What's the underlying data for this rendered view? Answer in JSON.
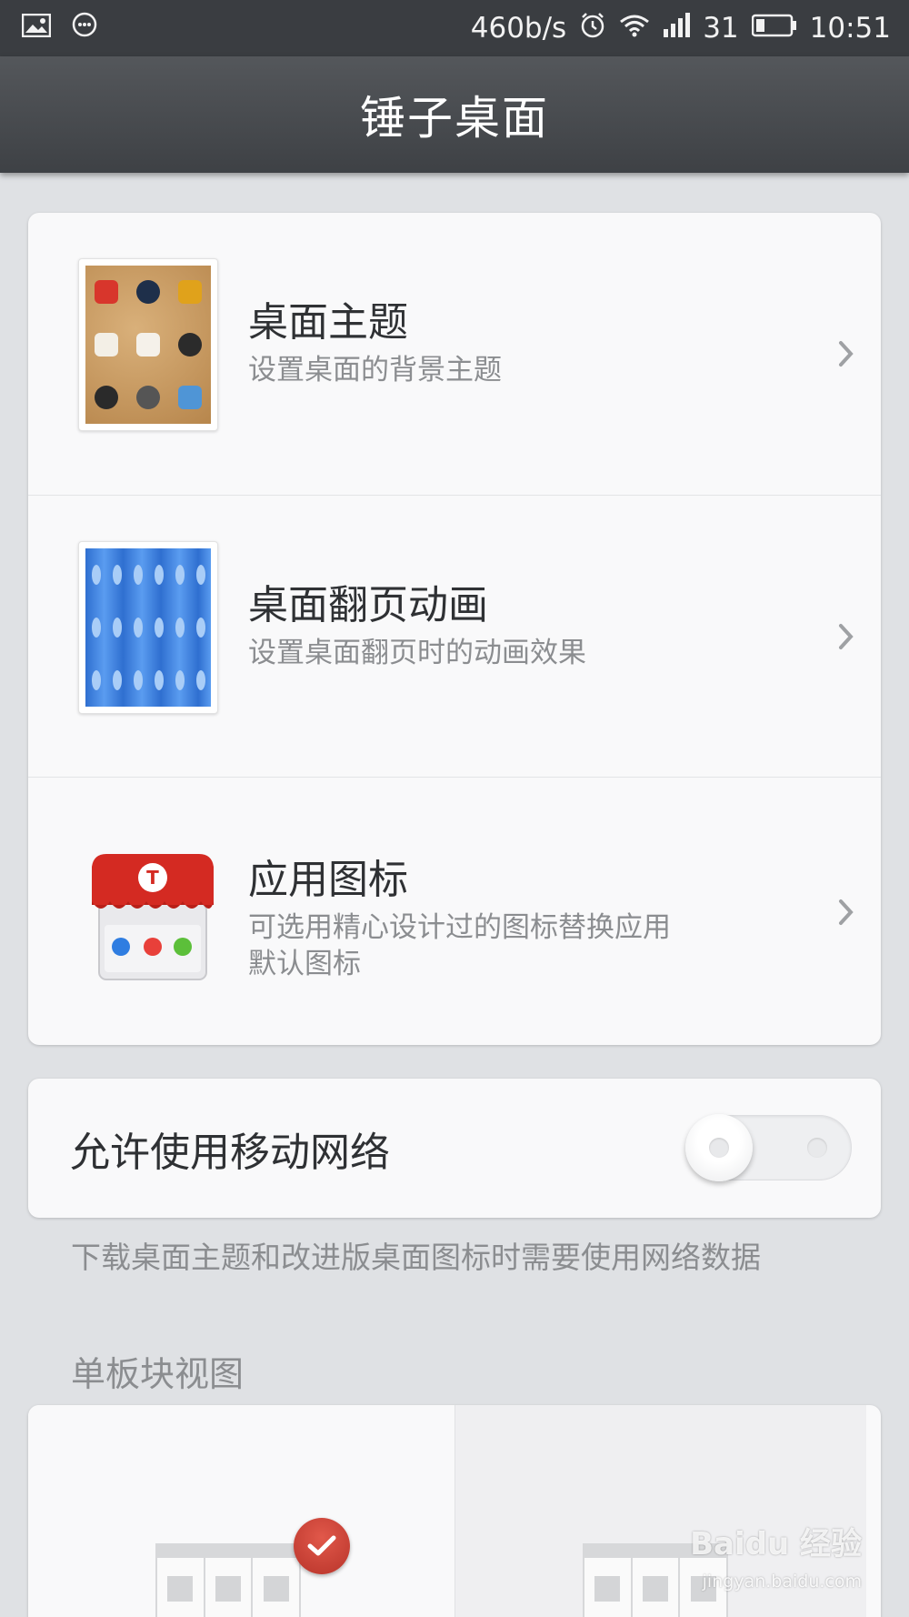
{
  "status_bar": {
    "icons_left": [
      "image-icon",
      "chat-bubble-icon"
    ],
    "net_speed": "460b/s",
    "signal_level": "31",
    "time": "10:51"
  },
  "header": {
    "title": "锤子桌面"
  },
  "settings": [
    {
      "title": "桌面主题",
      "subtitle": "设置桌面的背景主题",
      "icon": "theme-thumbnail"
    },
    {
      "title": "桌面翻页动画",
      "subtitle": "设置桌面翻页时的动画效果",
      "icon": "flip-animation-thumbnail"
    },
    {
      "title": "应用图标",
      "subtitle_line1": "可选用精心设计过的图标替换应用",
      "subtitle_line2": "默认图标",
      "icon": "app-store-icon"
    }
  ],
  "network": {
    "label": "允许使用移动网络",
    "enabled": false,
    "hint": "下载桌面主题和改进版桌面图标时需要使用网络数据"
  },
  "single_panel": {
    "section_title": "单板块视图"
  },
  "watermark": {
    "text": "Baidu 经验",
    "sub": "jingyan.baidu.com"
  },
  "colors": {
    "accent": "#c8413a",
    "title_bar": "#484b4f",
    "background": "#dfe1e4"
  }
}
